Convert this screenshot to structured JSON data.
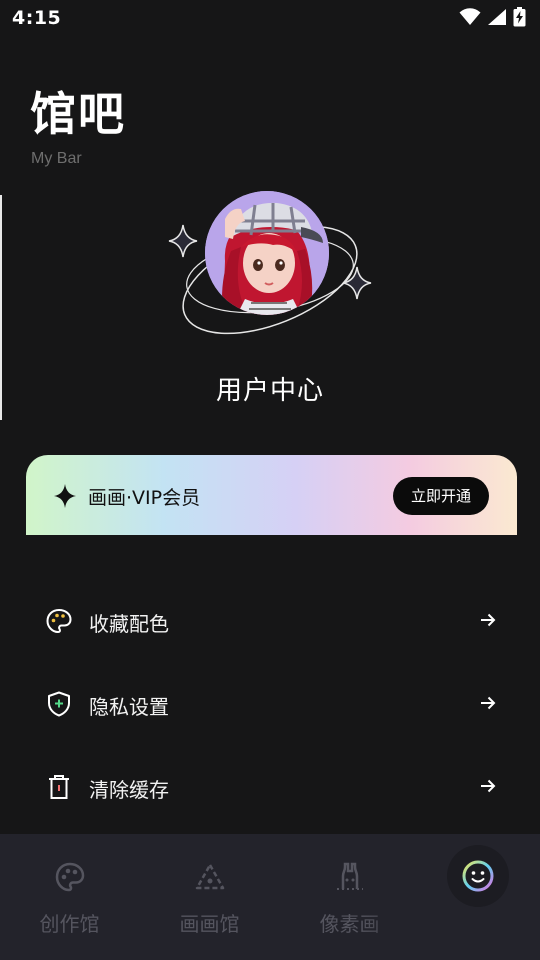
{
  "status_bar": {
    "time": "4:15",
    "icons": [
      "wifi-icon",
      "signal-icon",
      "battery-charging-icon"
    ]
  },
  "header": {
    "title": "馆吧",
    "subtitle": "My Bar"
  },
  "profile": {
    "title": "用户中心"
  },
  "vip": {
    "label": "画画·VIP会员",
    "button": "立即开通",
    "gradient": [
      "#d1f5c9",
      "#c3e3f3",
      "#d6d0f5",
      "#f4cbe1",
      "#fbe9d1"
    ]
  },
  "menu": [
    {
      "label": "收藏配色",
      "icon": "palette-icon"
    },
    {
      "label": "隐私设置",
      "icon": "shield-plus-icon"
    },
    {
      "label": "清除缓存",
      "icon": "trash-icon"
    }
  ],
  "bottom_nav": {
    "items": [
      {
        "label": "创作馆",
        "icon": "palette-icon"
      },
      {
        "label": "画画馆",
        "icon": "triangle-icon"
      },
      {
        "label": "像素画",
        "icon": "bunny-icon"
      },
      {
        "label": "",
        "icon": "smiley-icon"
      }
    ],
    "active_index": 3
  },
  "colors": {
    "background": "#161617",
    "nav_background": "#23232b",
    "nav_inactive": "#55555f",
    "active_ring": [
      "#f0e65a",
      "#60d0f0",
      "#e070e0"
    ]
  }
}
